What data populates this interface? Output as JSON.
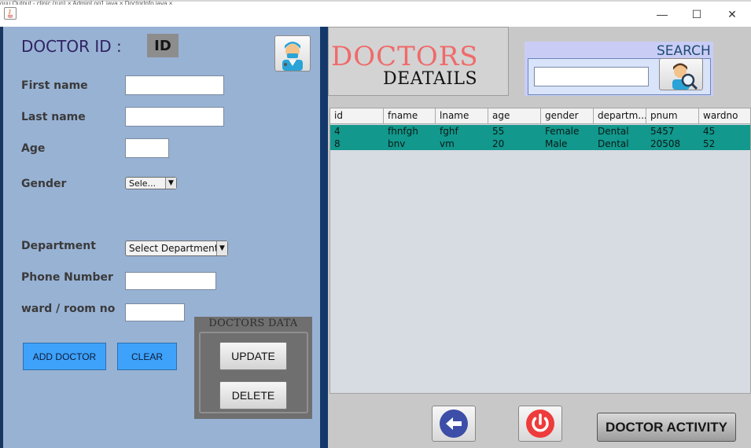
{
  "window": {
    "background_tabs": "ouu   Output - clinic (run)   ×   AdminLog1.java   ×   DoctorInfo.java   ×",
    "minimize_glyph": "—",
    "maximize_glyph": "☐",
    "close_glyph": "✕"
  },
  "form": {
    "doctor_id_label": "DOCTOR ID  :",
    "doctor_id_value": "ID",
    "first_name_label": "First name",
    "last_name_label": "Last name",
    "age_label": "Age",
    "gender_label": "Gender",
    "gender_selected": "Sele...",
    "department_label": "Department",
    "department_selected": "Select Department",
    "phone_label": "Phone Number",
    "ward_label": "ward / room no",
    "add_button": "ADD DOCTOR",
    "clear_button": "CLEAR",
    "data_group_title": "DOCTORS DATA",
    "update_button": "UPDATE",
    "delete_button": "DELETE"
  },
  "header": {
    "title_line1": "DOCTORS",
    "title_line2": "DEATAILS",
    "search_label": "SEARCH",
    "search_value": ""
  },
  "table": {
    "columns": [
      "id",
      "fname",
      "lname",
      "age",
      "gender",
      "departm...",
      "pnum",
      "wardno"
    ],
    "rows": [
      [
        "4",
        "fhnfgh",
        "fghf",
        "55",
        "Female",
        "Dental",
        "5457",
        "45"
      ],
      [
        "8",
        "bnv",
        "vm",
        "20",
        "Male",
        "Dental",
        "20508",
        "52"
      ]
    ]
  },
  "footer": {
    "activity_button": "DOCTOR ACTIVITY"
  },
  "icons": {
    "back": "arrow-left-icon",
    "power": "power-icon",
    "doctor": "doctor-avatar-icon",
    "search": "search-person-icon"
  },
  "colors": {
    "left_panel": "#98b2d4",
    "selected_row": "#12988c",
    "doctors_title": "#f06a6a",
    "blue_button": "#3ea2fb"
  }
}
